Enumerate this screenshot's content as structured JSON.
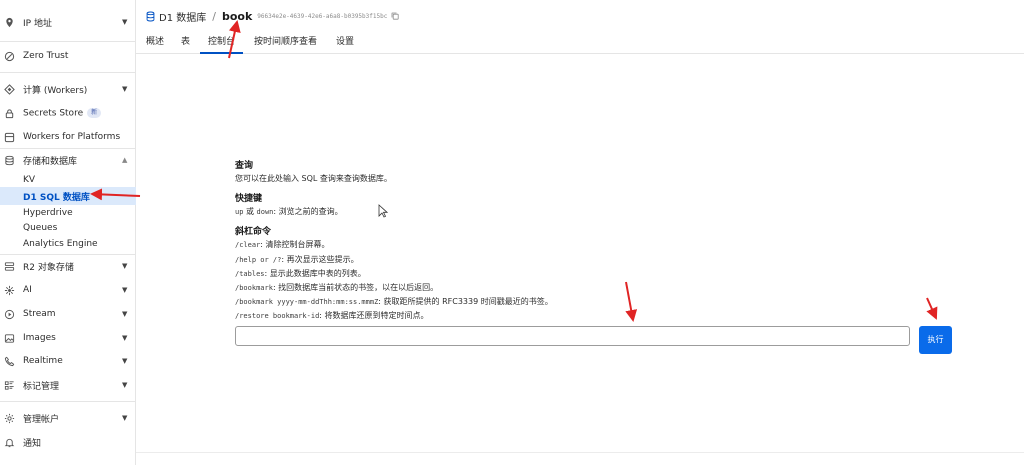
{
  "sidebar": {
    "items": [
      {
        "label": "IP 地址",
        "icon": "location-pin-icon",
        "chevron": true
      },
      {
        "label": "Zero Trust",
        "icon": "zero-trust-icon",
        "chevron": false
      },
      {
        "label": "计算 (Workers)",
        "icon": "workers-icon",
        "chevron": true
      },
      {
        "label": "Secrets Store",
        "icon": "lock-icon",
        "badge": "新",
        "chevron": false
      },
      {
        "label": "Workers for Platforms",
        "icon": "platforms-icon",
        "chevron": false
      },
      {
        "label": "存储和数据库",
        "icon": "database-icon",
        "chevron": true,
        "expanded": true
      },
      {
        "label": "KV"
      },
      {
        "label": "D1 SQL 数据库",
        "active": true
      },
      {
        "label": "Hyperdrive"
      },
      {
        "label": "Queues"
      },
      {
        "label": "Analytics Engine"
      },
      {
        "label": "R2 对象存储",
        "icon": "r2-storage-icon",
        "chevron": true
      },
      {
        "label": "AI",
        "icon": "ai-icon",
        "chevron": true
      },
      {
        "label": "Stream",
        "icon": "stream-icon",
        "chevron": true
      },
      {
        "label": "Images",
        "icon": "image-icon",
        "chevron": true
      },
      {
        "label": "Realtime",
        "icon": "phone-icon",
        "chevron": true
      },
      {
        "label": "标记管理",
        "icon": "tag-icon",
        "chevron": true
      },
      {
        "label": "管理帐户",
        "icon": "gear-icon",
        "chevron": true
      },
      {
        "label": "通知",
        "icon": "bell-icon",
        "chevron": false
      }
    ]
  },
  "header": {
    "breadcrumb_parent": "D1 数据库",
    "separator": "/",
    "db_name": "book",
    "db_id": "96634e2e-4639-42e6-a6a8-b0395b3f15bc"
  },
  "tabs": [
    "概述",
    "表",
    "控制台",
    "按时间顺序查看",
    "设置"
  ],
  "active_tab": "控制台",
  "console": {
    "query_heading": "查询",
    "query_desc": "您可以在此处输入 SQL 查询来查询数据库。",
    "shortcut_heading": "快捷键",
    "shortcut_code": "up",
    "shortcut_or": "或",
    "shortcut_code2": "down",
    "shortcut_desc": ": 浏览之前的查询。",
    "slash_heading": "斜杠命令",
    "commands": [
      {
        "cmd": "/clear",
        "desc": ": 清除控制台屏幕。"
      },
      {
        "cmd": "/help or /?",
        "desc": ": 再次显示这些提示。"
      },
      {
        "cmd": "/tables",
        "desc": ": 显示此数据库中表的列表。"
      },
      {
        "cmd": "/bookmark",
        "desc": ": 找回数据库当前状态的书签，以在以后返回。"
      },
      {
        "cmd": "/bookmark yyyy-mm-ddThh:mm:ss.mmmZ",
        "desc": ": 获取距所提供的 RFC3339 时间戳最近的书签。"
      },
      {
        "cmd": "/restore bookmark-id",
        "desc": ": 将数据库还原到特定时间点。"
      }
    ],
    "input_value": "",
    "run_label": "执行"
  },
  "colors": {
    "accent": "#0051c3",
    "button": "#0a6bea",
    "arrow": "#e02424"
  }
}
